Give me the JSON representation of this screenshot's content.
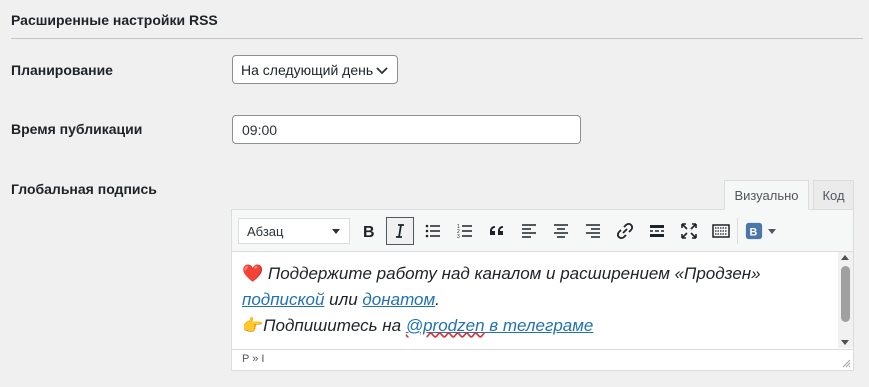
{
  "section": {
    "title": "Расширенные настройки RSS"
  },
  "fields": {
    "schedule": {
      "label": "Планирование",
      "value": "На следующий день"
    },
    "publish_time": {
      "label": "Время публикации",
      "value": "09:00"
    },
    "signature": {
      "label": "Глобальная подпись"
    }
  },
  "editor": {
    "tabs": {
      "visual": "Визуально",
      "code": "Код"
    },
    "format_select": "Абзац",
    "toolbar_icons": [
      "bold-icon",
      "italic-icon",
      "bullet-list-icon",
      "numbered-list-icon",
      "blockquote-icon",
      "align-left-icon",
      "align-center-icon",
      "align-right-icon",
      "link-icon",
      "read-more-icon",
      "fullscreen-icon",
      "toolbar-toggle-icon",
      "plugin-icon"
    ],
    "content": {
      "line1_emoji": "❤️",
      "line1_text": " Поддержите работу над каналом и расширением «Продзен»",
      "link_subscription": "подпиской",
      "or_text": " или ",
      "link_donate": "донатом",
      "period": ".",
      "line3_emoji": "👉",
      "line3_text": "Подпишитесь на ",
      "link_telegram_handle": "@prodzen",
      "link_telegram_rest": " в телеграме"
    },
    "status_path": "P » I"
  },
  "colors": {
    "accent": "#2271b1",
    "text": "#1d2327",
    "background": "#f0f0f1"
  }
}
